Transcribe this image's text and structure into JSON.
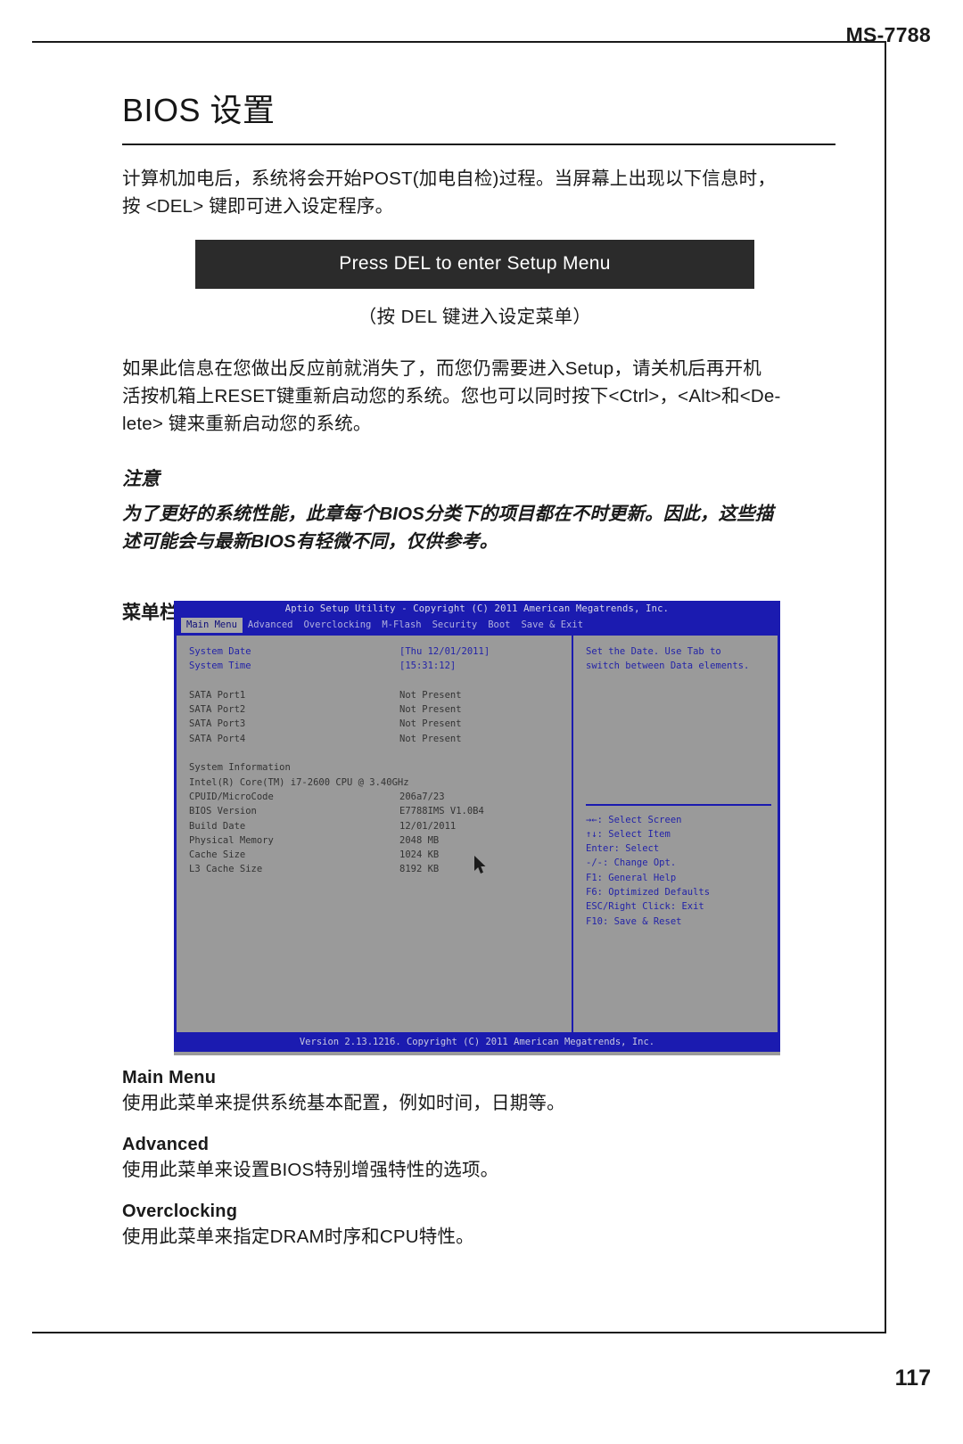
{
  "header": {
    "model": "MS-7788"
  },
  "footer": {
    "page_number": "117"
  },
  "chapter": {
    "title": "BIOS 设置",
    "intro_line1": "计算机加电后，系统将会开始POST(加电自检)过程。当屏幕上出现以下信息时，",
    "intro_line2": "按 <DEL> 键即可进入设定程序。"
  },
  "post_banner": {
    "message": "Press DEL to enter Setup Menu",
    "caption": "（按 DEL 键进入设定菜单）"
  },
  "paragraph": {
    "line1": "如果此信息在您做出反应前就消失了，而您仍需要进入Setup，请关机后再开机",
    "line2": "活按机箱上RESET键重新启动您的系统。您也可以同时按下<Ctrl>，<Alt>和<De-",
    "line3": "lete> 键来重新启动您的系统。"
  },
  "note": {
    "heading": "注意",
    "line1": "为了更好的系统性能，此章每个BIOS分类下的项目都在不时更新。因此，这些描",
    "line2": "述可能会与最新BIOS有轻微不同，仅供参考。"
  },
  "menubar_section": {
    "heading": "菜单栏"
  },
  "bios": {
    "title": "Aptio Setup Utility - Copyright (C) 2011 American Megatrends, Inc.",
    "footer": "Version 2.13.1216. Copyright (C) 2011 American Megatrends, Inc.",
    "tabs": [
      {
        "label": "Main Menu",
        "active": true
      },
      {
        "label": "Advanced",
        "active": false
      },
      {
        "label": "Overclocking",
        "active": false
      },
      {
        "label": "M-Flash",
        "active": false
      },
      {
        "label": "Security",
        "active": false
      },
      {
        "label": "Boot",
        "active": false
      },
      {
        "label": "Save & Exit",
        "active": false
      }
    ],
    "rows": [
      {
        "label": "System Date",
        "value": "[Thu 12/01/2011]",
        "style": "highlight"
      },
      {
        "label": "System Time",
        "value": "[15:31:12]",
        "style": "highlight"
      },
      {
        "label": "",
        "value": "",
        "style": "spacer"
      },
      {
        "label": "SATA Port1",
        "value": "Not Present",
        "style": "dim"
      },
      {
        "label": "SATA Port2",
        "value": "Not Present",
        "style": "dim"
      },
      {
        "label": "SATA Port3",
        "value": "Not Present",
        "style": "dim"
      },
      {
        "label": "SATA Port4",
        "value": "Not Present",
        "style": "dim"
      },
      {
        "label": "",
        "value": "",
        "style": "spacer"
      },
      {
        "label": "System Information",
        "value": "",
        "style": "dim"
      },
      {
        "label": "Intel(R) Core(TM) i7-2600 CPU @ 3.40GHz",
        "value": "",
        "style": "dim"
      },
      {
        "label": "CPUID/MicroCode",
        "value": "206a7/23",
        "style": "dim"
      },
      {
        "label": "BIOS Version",
        "value": "E7788IMS V1.0B4",
        "style": "dim"
      },
      {
        "label": "Build Date",
        "value": "12/01/2011",
        "style": "dim"
      },
      {
        "label": "Physical Memory",
        "value": "2048 MB",
        "style": "dim"
      },
      {
        "label": "Cache Size",
        "value": "1024 KB",
        "style": "dim"
      },
      {
        "label": "L3 Cache Size",
        "value": "8192 KB",
        "style": "dim"
      }
    ],
    "help": {
      "line1": "Set the Date. Use Tab to",
      "line2": "switch between Data elements."
    },
    "keys": [
      "→←: Select Screen",
      "↑↓: Select Item",
      "Enter: Select",
      "-/-: Change Opt.",
      "F1: General Help",
      "F6: Optimized Defaults",
      "ESC/Right Click: Exit",
      "F10: Save & Reset"
    ]
  },
  "menu_descriptions": [
    {
      "name": "Main Menu",
      "desc": "使用此菜单来提供系统基本配置，例如时间，日期等。"
    },
    {
      "name": "Advanced",
      "desc": "使用此菜单来设置BIOS特别增强特性的选项。"
    },
    {
      "name": "Overclocking",
      "desc": "使用此菜单来指定DRAM时序和CPU特性。"
    }
  ]
}
